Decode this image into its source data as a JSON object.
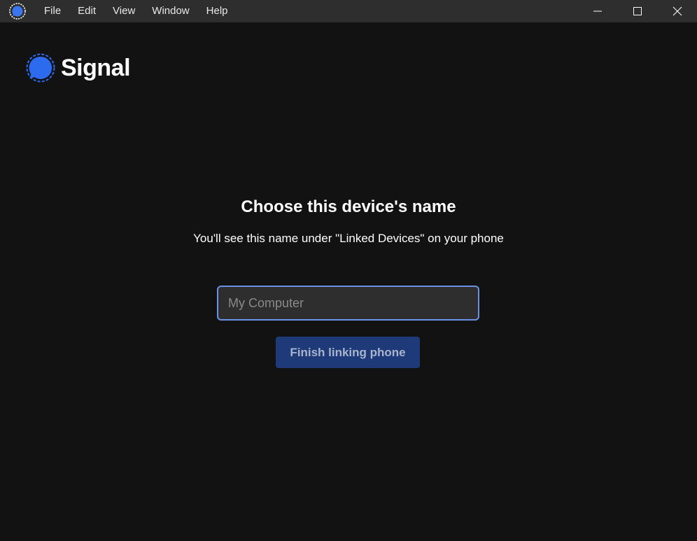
{
  "window": {
    "menu": [
      "File",
      "Edit",
      "View",
      "Window",
      "Help"
    ],
    "controls": {
      "minimize_icon": "minimize-icon",
      "maximize_icon": "maximize-icon",
      "close_icon": "close-icon"
    }
  },
  "brand": {
    "name": "Signal",
    "icon": "signal-logo-icon",
    "accent_color": "#2c6bed"
  },
  "main": {
    "heading": "Choose this device's name",
    "subtext": "You'll see this name under \"Linked Devices\" on your phone",
    "name_input": {
      "value": "",
      "placeholder": "My Computer"
    },
    "finish_button": "Finish linking phone"
  }
}
